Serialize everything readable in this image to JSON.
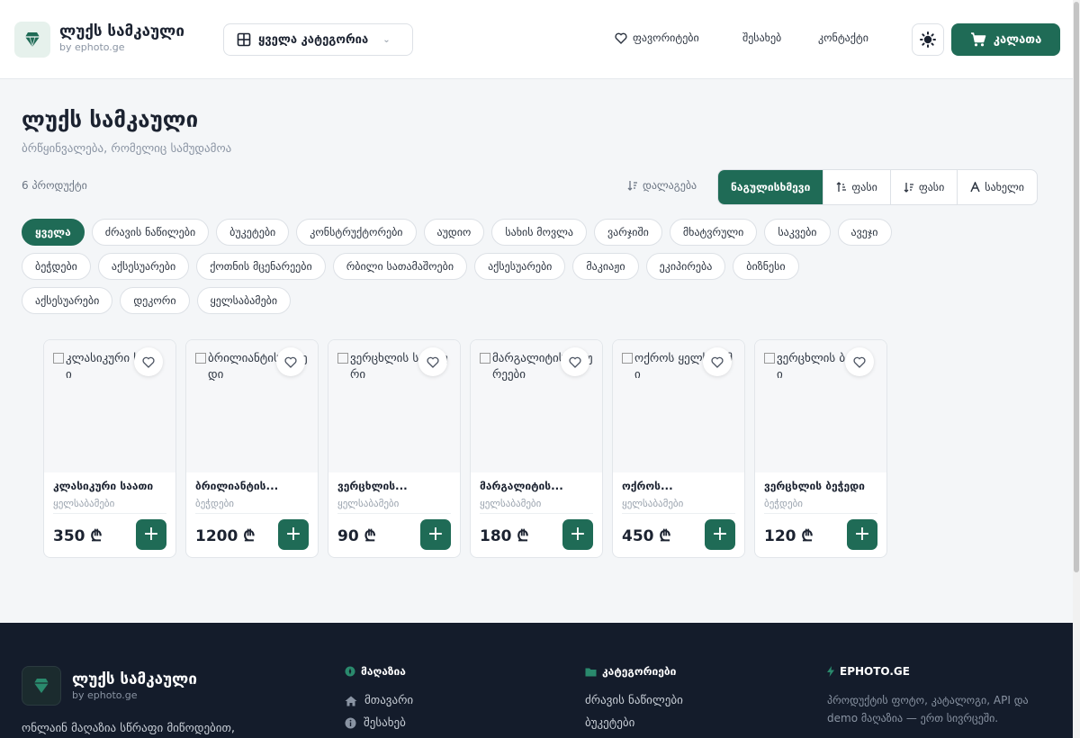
{
  "header": {
    "brand_title": "ლუქს სამკაული",
    "brand_sub": "by ephoto.ge",
    "category_select": "ყველა კატეგორია",
    "nav": {
      "favorites": "ფავორიტები",
      "about": "შესახებ",
      "contact": "კონტაქტი"
    },
    "cart_label": "კალათა"
  },
  "page": {
    "title": "ლუქს სამკაული",
    "subtitle": "ბრწყინვალება, რომელიც სამუდამოა",
    "count": "6 პროდუქტი",
    "sort_label": "დალაგება",
    "sort_options": [
      "ნაგულისხმევი",
      "ფასი",
      "ფასი",
      "სახელი"
    ]
  },
  "chips": [
    [
      "ყველა",
      "ძრავის ნაწილები",
      "ბუკეტები",
      "კონსტრუქტორები",
      "აუდიო",
      "სახის მოვლა",
      "ვარჯიში",
      "მხატვრული",
      "საკვები",
      "ავეჯი"
    ],
    [
      "ბეჭდები",
      "აქსესუარები",
      "ქოთნის მცენარეები",
      "რბილი სათამაშოები",
      "აქსესუარები",
      "მაკიაჟი",
      "ეკიპირება",
      "ბიზნესი"
    ],
    [
      "აქსესუარები",
      "დეკორი",
      "ყელსაბამები"
    ]
  ],
  "products": [
    {
      "alt": "კლასიკური საათი",
      "name": "კლასიკური საათი",
      "category": "ყელსაბამები",
      "price": "350 ₾"
    },
    {
      "alt": "ბრილიანტის ბეჭედი",
      "name": "ბრილიანტის...",
      "category": "ბეჭდები",
      "price": "1200 ₾"
    },
    {
      "alt": "ვერცხლის სამაჯური",
      "name": "ვერცხლის...",
      "category": "ყელსაბამები",
      "price": "90 ₾"
    },
    {
      "alt": "მარგალიტის საყურეები",
      "name": "მარგალიტის...",
      "category": "ყელსაბამები",
      "price": "180 ₾"
    },
    {
      "alt": "ოქროს ყელსაბამი",
      "name": "ოქროს...",
      "category": "ყელსაბამები",
      "price": "450 ₾"
    },
    {
      "alt": "ვერცხლის ბეჭედი",
      "name": "ვერცხლის ბეჭედი",
      "category": "ბეჭდები",
      "price": "120 ₾"
    }
  ],
  "footer": {
    "brand_title": "ლუქს სამკაული",
    "brand_sub": "by ephoto.ge",
    "description": "ონლაინ მაღაზია სწრაფი მიწოდებით,",
    "col_shop": "მაღაზია",
    "shop_links": [
      "მთავარი",
      "შესახებ"
    ],
    "col_categories": "კატეგორიები",
    "category_links": [
      "ძრავის ნაწილები",
      "ბუკეტები"
    ],
    "col_ephoto": "EPHOTO.GE",
    "ephoto_text": "პროდუქტის ფოტო, კატალოგი, API და demo მაღაზია — ერთ სივრცეში."
  },
  "colors": {
    "accent": "#1f6b56",
    "footer_bg": "#141c2b"
  }
}
